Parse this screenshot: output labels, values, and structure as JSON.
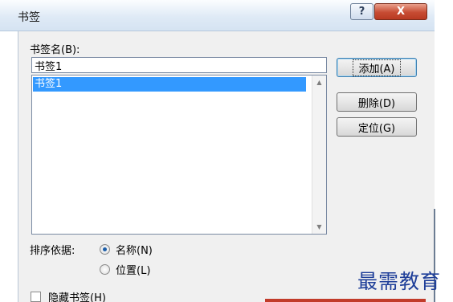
{
  "window": {
    "title": "书签",
    "help_label": "?",
    "close_label": "X"
  },
  "form": {
    "name_label": "书签名(B):",
    "name_value": "书签1",
    "list_items": [
      "书签1"
    ],
    "sort_label": "排序依据:",
    "sort_options": [
      {
        "label": "名称(N)",
        "checked": true
      },
      {
        "label": "位置(L)",
        "checked": false
      }
    ],
    "hidden_label": "隐藏书签(H)",
    "hidden_checked": false
  },
  "buttons": {
    "add": "添加(A)",
    "delete": "删除(D)",
    "goto": "定位(G)"
  },
  "watermark": "最需教育",
  "colors": {
    "selection": "#3399ff",
    "close_button": "#c74c33"
  }
}
